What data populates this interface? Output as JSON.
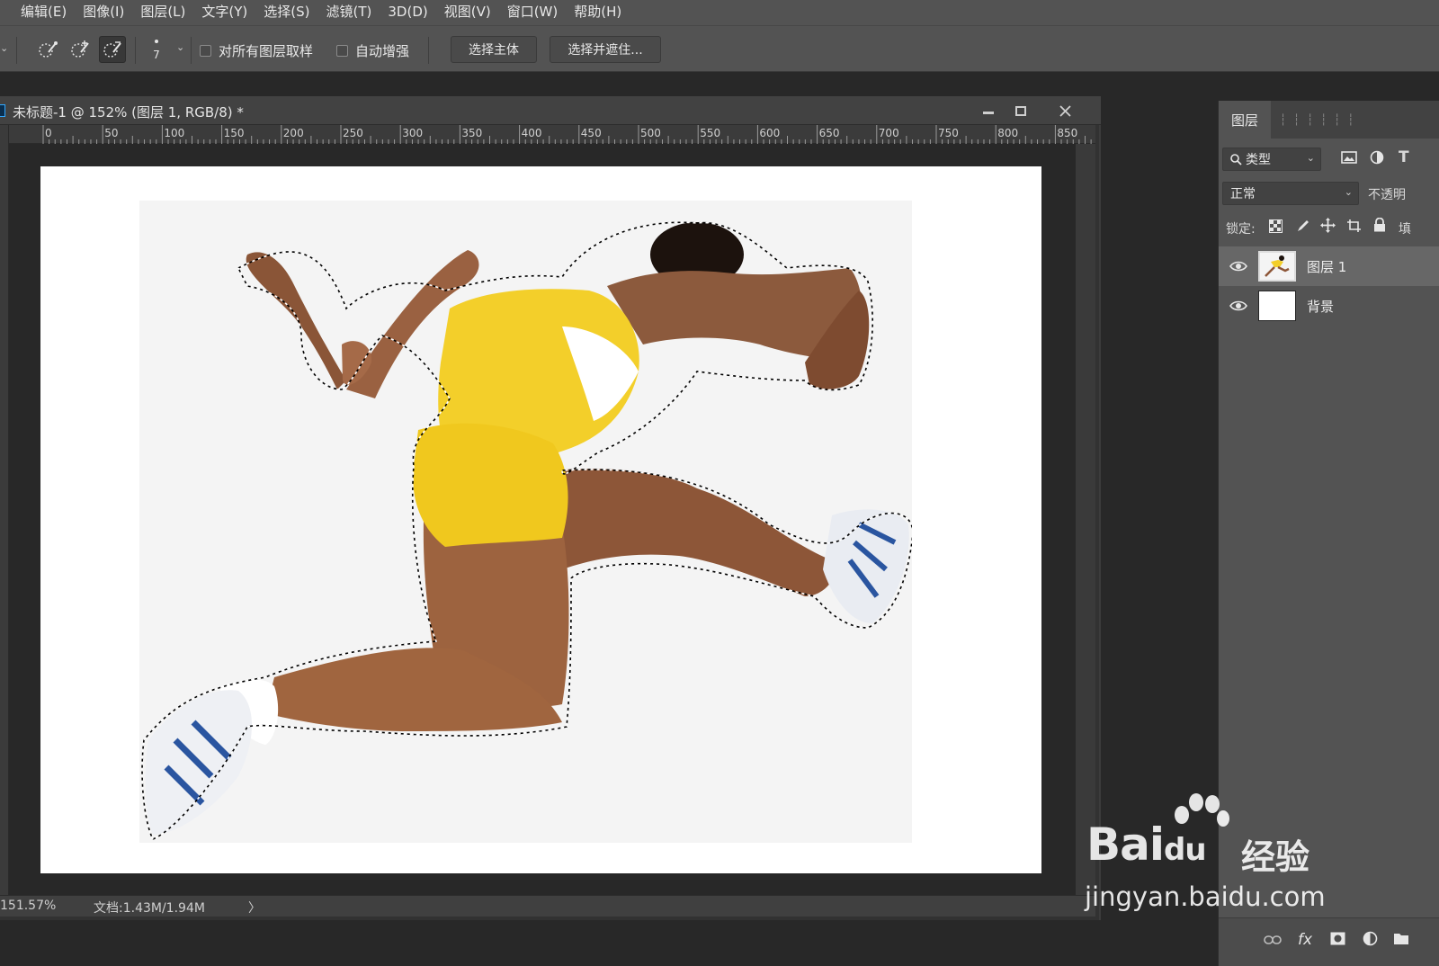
{
  "menubar": {
    "items": [
      {
        "label": "编辑(E)"
      },
      {
        "label": "图像(I)"
      },
      {
        "label": "图层(L)"
      },
      {
        "label": "文字(Y)"
      },
      {
        "label": "选择(S)"
      },
      {
        "label": "滤镜(T)"
      },
      {
        "label": "3D(D)"
      },
      {
        "label": "视图(V)"
      },
      {
        "label": "窗口(W)"
      },
      {
        "label": "帮助(H)"
      }
    ]
  },
  "options": {
    "brush_size": "7",
    "sample_all_layers": "对所有图层取样",
    "auto_enhance": "自动增强",
    "select_subject": "选择主体",
    "select_and_mask": "选择并遮住..."
  },
  "document": {
    "title": "未标题-1 @ 152% (图层 1, RGB/8) *",
    "ruler_labels": [
      "0",
      "50",
      "100",
      "150",
      "200",
      "250",
      "300",
      "350",
      "400",
      "450",
      "500",
      "550",
      "600",
      "650",
      "700",
      "750",
      "800",
      "850"
    ],
    "zoom": "151.57%",
    "doc_size": "文档:1.43M/1.94M",
    "status_arrow": "〉"
  },
  "layers_panel": {
    "tab": "图层",
    "filter_kind": "类型",
    "blend_mode": "正常",
    "opacity_label": "不透明",
    "lock_label": "锁定:",
    "fill_label": "填",
    "layers": [
      {
        "name": "图层 1",
        "selected": true
      },
      {
        "name": "背景",
        "selected": false
      }
    ]
  },
  "watermark": {
    "brand": "Bai",
    "brand_suffix": "du",
    "jingyan": "经验",
    "url": "jingyan.baidu.com"
  },
  "colors": {
    "selection_outline": "#000000",
    "jersey": "#f3cf2a"
  }
}
